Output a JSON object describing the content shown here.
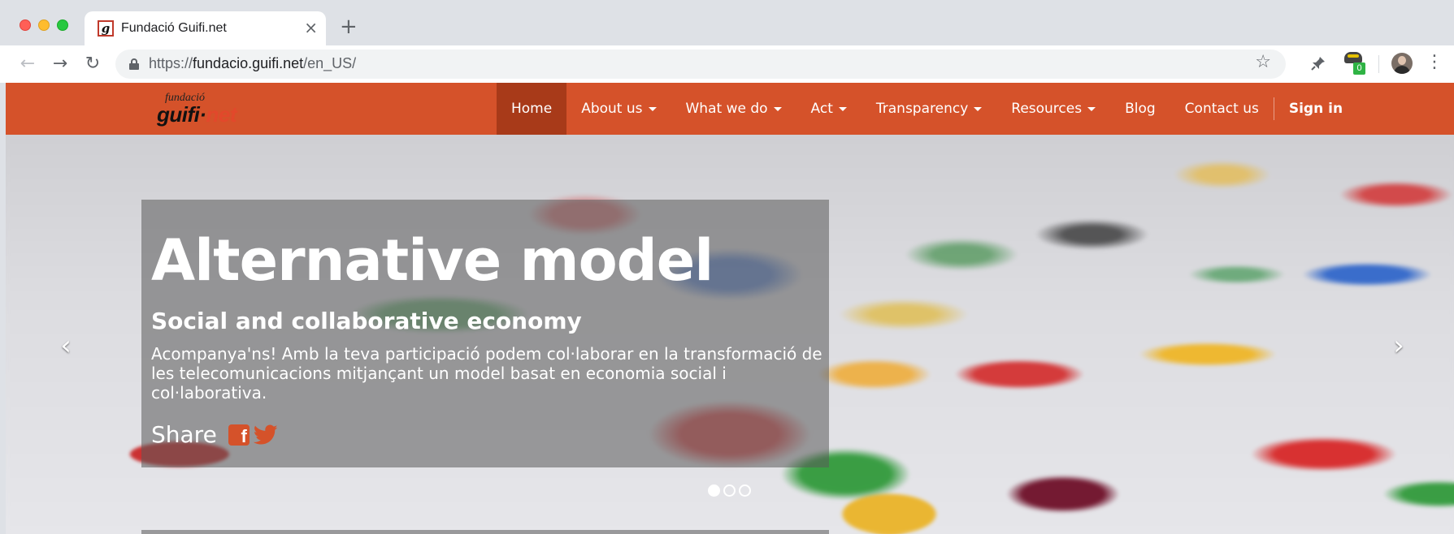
{
  "browser": {
    "tab_title": "Fundació Guifi.net",
    "tab_close": "×",
    "new_tab": "+",
    "url_scheme": "https://",
    "url_host": "fundacio.guifi.net",
    "url_path": "/en_US/",
    "back": "←",
    "forward": "→",
    "reload": "↻",
    "star": "☆",
    "extension_badge": "0",
    "menu": "⋮",
    "icons": [
      "lock-icon",
      "star-icon",
      "pin-extension-icon",
      "extension-icon",
      "profile-avatar",
      "menu-icon"
    ]
  },
  "site": {
    "logo_small": "fundació",
    "logo_main": "guifi·",
    "logo_accent": "net",
    "nav": {
      "home": "Home",
      "about": "About us",
      "what_we_do": "What we do",
      "act": "Act",
      "transparency": "Transparency",
      "resources": "Resources",
      "blog": "Blog",
      "contact": "Contact us",
      "sign_in": "Sign in"
    },
    "active_nav": "Home"
  },
  "hero": {
    "title": "Alternative model",
    "subtitle": "Social and collaborative economy",
    "body": "Acompanya'ns! Amb la teva participació podem col·laborar en la transformació de les telecomunicacions mitjançant un model basat en economia social i col·laborativa.",
    "share_label": "Share",
    "facebook_glyph": "f",
    "prev_arrow": "‹",
    "next_arrow": "›",
    "slides_count": 3,
    "active_slide": 1
  },
  "colors": {
    "brand": "#d5522a",
    "brand_active": "#a83a19"
  }
}
